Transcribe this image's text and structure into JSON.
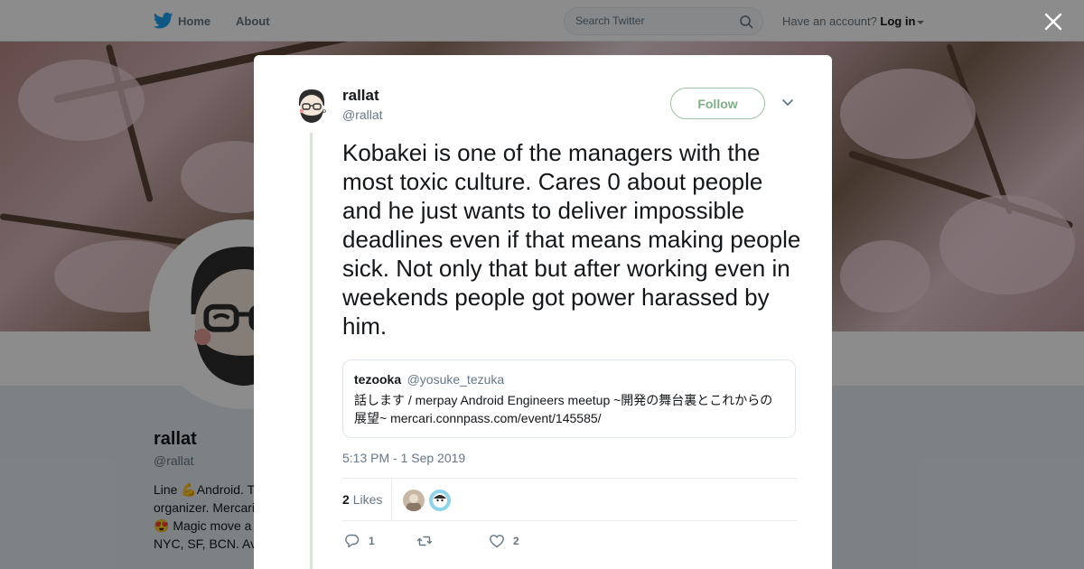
{
  "topbar": {
    "home_label": "Home",
    "about_label": "About",
    "search_placeholder": "Search Twitter",
    "account_prompt": "Have an account?",
    "login_label": "Log in"
  },
  "profile": {
    "name": "rallat",
    "handle": "@rallat",
    "bio_lines": [
      "Line 💪Android. T",
      "organizer. Mercari",
      "😍 Magic move a",
      "NYC, SF, BCN. Av"
    ]
  },
  "tweet": {
    "author_name": "rallat",
    "author_handle": "@rallat",
    "follow_label": "Follow",
    "text": "Kobakei is one of the managers with the most toxic culture. Cares 0 about people and he just wants to deliver impossible deadlines even if that means making people sick. Not only that but after working even in weekends people got power harassed by him.",
    "quote": {
      "name": "tezooka",
      "handle": "@yosuke_tezuka",
      "text": "話します / merpay Android Engineers meetup ~開発の舞台裏とこれからの展望~ mercari.connpass.com/event/145585/"
    },
    "timestamp": "5:13 PM - 1 Sep 2019",
    "likes_count": "2",
    "likes_label": "Likes",
    "replies_count": "1",
    "retweets_count": "",
    "favorites_count": "2"
  },
  "colors": {
    "accent": "#7fae87",
    "thread_line": "#d6e6d3",
    "muted": "#657786"
  },
  "icons": [
    "twitter-bird-icon",
    "search-icon",
    "close-icon",
    "chevron-down-icon",
    "reply-icon",
    "retweet-icon",
    "heart-icon"
  ]
}
